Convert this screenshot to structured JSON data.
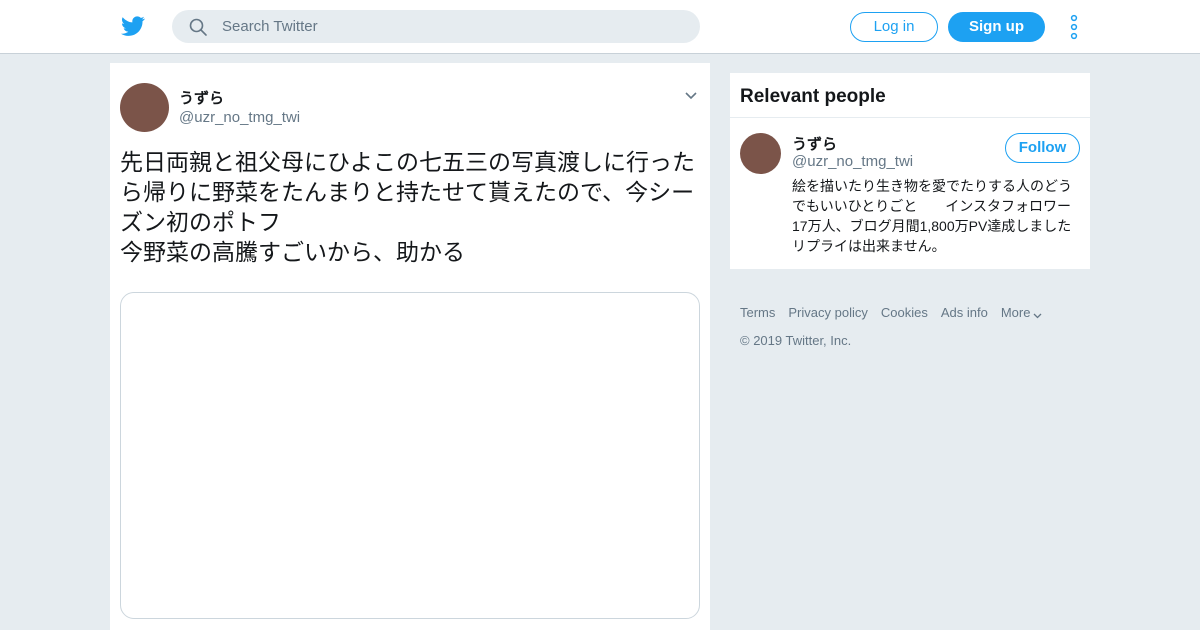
{
  "header": {
    "search_placeholder": "Search Twitter",
    "login_label": "Log in",
    "signup_label": "Sign up"
  },
  "tweet": {
    "author_name": "うずら",
    "author_handle": "@uzr_no_tmg_twi",
    "text": "先日両親と祖父母にひよこの七五三の写真渡しに行ったら帰りに野菜をたんまりと持たせて貰えたので、今シーズン初のポトフ\n今野菜の高騰すごいから、助かる"
  },
  "relevant_people": {
    "title": "Relevant people",
    "person": {
      "name": "うずら",
      "handle": "@uzr_no_tmg_twi",
      "follow_label": "Follow",
      "bio": "絵を描いたり生き物を愛でたりする人のどうでもいいひとりごと　　インスタフォロワー17万人、ブログ月間1,800万PV達成しました　 リプライは出来ません。"
    }
  },
  "footer": {
    "links": [
      "Terms",
      "Privacy policy",
      "Cookies",
      "Ads info",
      "More"
    ],
    "copyright": "© 2019 Twitter, Inc."
  },
  "colors": {
    "accent": "#1da1f2",
    "background": "#e6ecf0",
    "avatar": "#7b5449",
    "secondary_text": "#657786"
  },
  "icons": [
    "twitter-bird-icon",
    "search-icon",
    "more-vertical-icon",
    "chevron-down-icon"
  ]
}
